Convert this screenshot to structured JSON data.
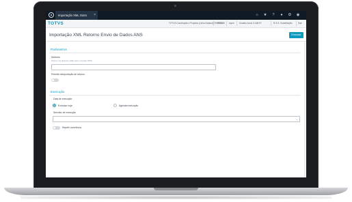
{
  "topbar": {
    "tab_label": "Importação XML Outro",
    "tab_close": "×",
    "icons": [
      "home-icon",
      "star-icon",
      "help-icon",
      "notifications-icon",
      "settings-icon",
      "user-icon"
    ]
  },
  "header": {
    "brand": "TOTVS",
    "context": [
      "TOTVS Construção e Projetos (Linha Datasul) 09.0.0000",
      "VRS/1.0",
      "espm",
      "Usuário local: 0.168.97",
      "R.S.S. Substituição",
      "Sair"
    ]
  },
  "page": {
    "title": "Importação XML Retorno Envio de Dados ANS",
    "run_button": "Executar"
  },
  "parameters": {
    "section_title": "Parâmetros",
    "directory_label": "Diretório",
    "directory_help": "Informe um diretório válido para o servidor RPW",
    "directory_value": "",
    "reimport_label": "Permite reimportação de retorno"
  },
  "execution": {
    "section_title": "Execução",
    "date_label": "Data de execução",
    "option_now": "Executar hoje",
    "option_schedule": "Agendar execução",
    "server_label": "Servidor de execução",
    "server_value": "",
    "repeat_label": "Repetir ocorrência"
  }
}
